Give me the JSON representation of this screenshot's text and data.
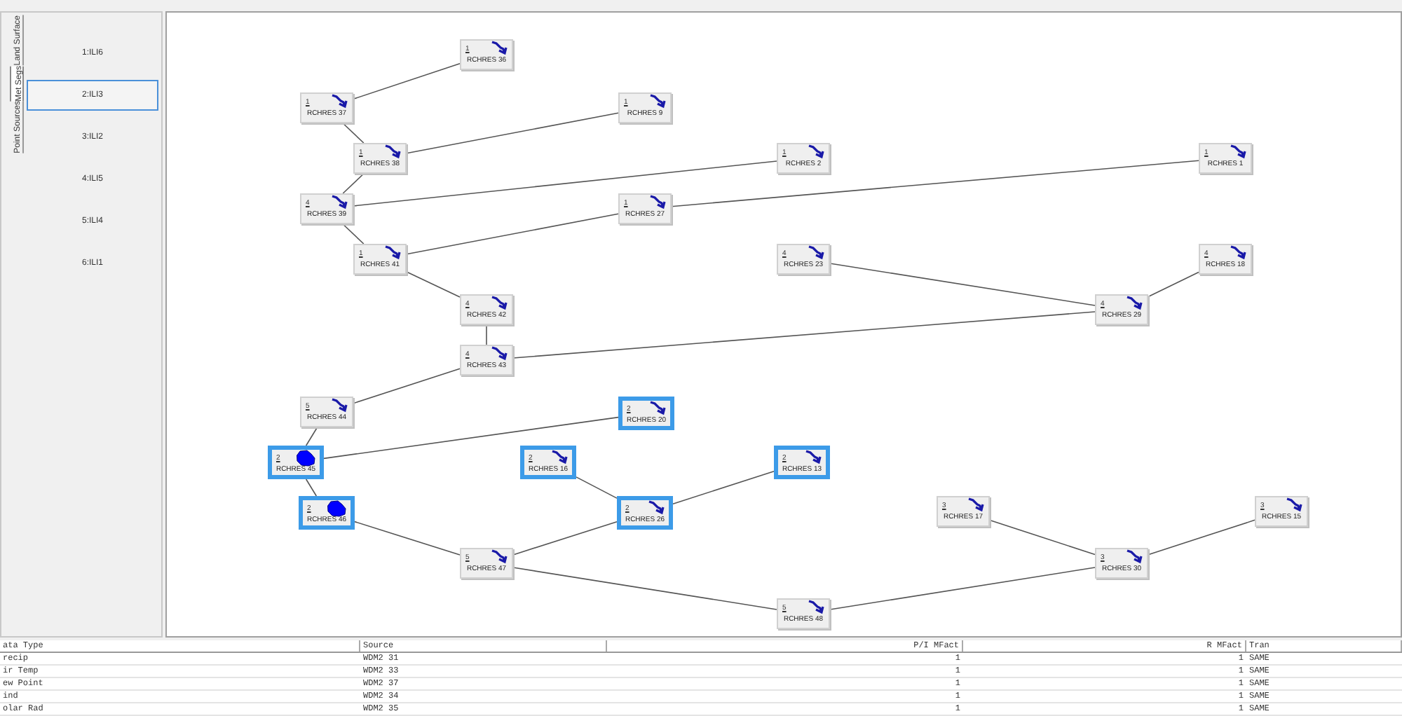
{
  "side_tabs": [
    {
      "label": "Land Surface",
      "selected": false
    },
    {
      "label": "Met Segs",
      "selected": true
    },
    {
      "label": "Point Sources",
      "selected": false
    }
  ],
  "segments": [
    {
      "label": "1:ILI6",
      "selected": false
    },
    {
      "label": "2:ILI3",
      "selected": true
    },
    {
      "label": "3:ILI2",
      "selected": false
    },
    {
      "label": "4:ILI5",
      "selected": false
    },
    {
      "label": "5:ILI4",
      "selected": false
    },
    {
      "label": "6:ILI1",
      "selected": false
    }
  ],
  "nodes": [
    {
      "segment": "1",
      "name": "RCHRES 36",
      "kind": "stream",
      "selected": false
    },
    {
      "segment": "1",
      "name": "RCHRES 37",
      "kind": "stream",
      "selected": false
    },
    {
      "segment": "1",
      "name": "RCHRES 9",
      "kind": "stream",
      "selected": false
    },
    {
      "segment": "1",
      "name": "RCHRES 38",
      "kind": "stream",
      "selected": false
    },
    {
      "segment": "1",
      "name": "RCHRES 2",
      "kind": "stream",
      "selected": false
    },
    {
      "segment": "1",
      "name": "RCHRES 1",
      "kind": "stream",
      "selected": false
    },
    {
      "segment": "4",
      "name": "RCHRES 39",
      "kind": "stream",
      "selected": false
    },
    {
      "segment": "1",
      "name": "RCHRES 27",
      "kind": "stream",
      "selected": false
    },
    {
      "segment": "1",
      "name": "RCHRES 41",
      "kind": "stream",
      "selected": false
    },
    {
      "segment": "4",
      "name": "RCHRES 23",
      "kind": "stream",
      "selected": false
    },
    {
      "segment": "4",
      "name": "RCHRES 18",
      "kind": "stream",
      "selected": false
    },
    {
      "segment": "4",
      "name": "RCHRES 42",
      "kind": "stream",
      "selected": false
    },
    {
      "segment": "4",
      "name": "RCHRES 29",
      "kind": "stream",
      "selected": false
    },
    {
      "segment": "4",
      "name": "RCHRES 43",
      "kind": "stream",
      "selected": false
    },
    {
      "segment": "5",
      "name": "RCHRES 44",
      "kind": "stream",
      "selected": false
    },
    {
      "segment": "2",
      "name": "RCHRES 20",
      "kind": "stream",
      "selected": true
    },
    {
      "segment": "2",
      "name": "RCHRES 45",
      "kind": "lake",
      "selected": true
    },
    {
      "segment": "2",
      "name": "RCHRES 16",
      "kind": "stream",
      "selected": true
    },
    {
      "segment": "2",
      "name": "RCHRES 13",
      "kind": "stream",
      "selected": true
    },
    {
      "segment": "2",
      "name": "RCHRES 46",
      "kind": "lake",
      "selected": true
    },
    {
      "segment": "2",
      "name": "RCHRES 26",
      "kind": "stream",
      "selected": true
    },
    {
      "segment": "3",
      "name": "RCHRES 17",
      "kind": "stream",
      "selected": false
    },
    {
      "segment": "3",
      "name": "RCHRES 15",
      "kind": "stream",
      "selected": false
    },
    {
      "segment": "5",
      "name": "RCHRES 47",
      "kind": "stream",
      "selected": false
    },
    {
      "segment": "3",
      "name": "RCHRES 30",
      "kind": "stream",
      "selected": false
    },
    {
      "segment": "5",
      "name": "RCHRES 48",
      "kind": "stream",
      "selected": false
    }
  ],
  "table": {
    "columns": [
      "ata Type",
      "Source",
      "P/I MFact",
      "R MFact",
      "Tran"
    ],
    "rows": [
      [
        "recip",
        "WDM2 31",
        "1",
        "1",
        "SAME"
      ],
      [
        "ir Temp",
        "WDM2 33",
        "1",
        "1",
        "SAME"
      ],
      [
        "ew Point",
        "WDM2 37",
        "1",
        "1",
        "SAME"
      ],
      [
        "ind",
        "WDM2 34",
        "1",
        "1",
        "SAME"
      ],
      [
        "olar Rad",
        "WDM2 35",
        "1",
        "1",
        "SAME"
      ]
    ]
  }
}
